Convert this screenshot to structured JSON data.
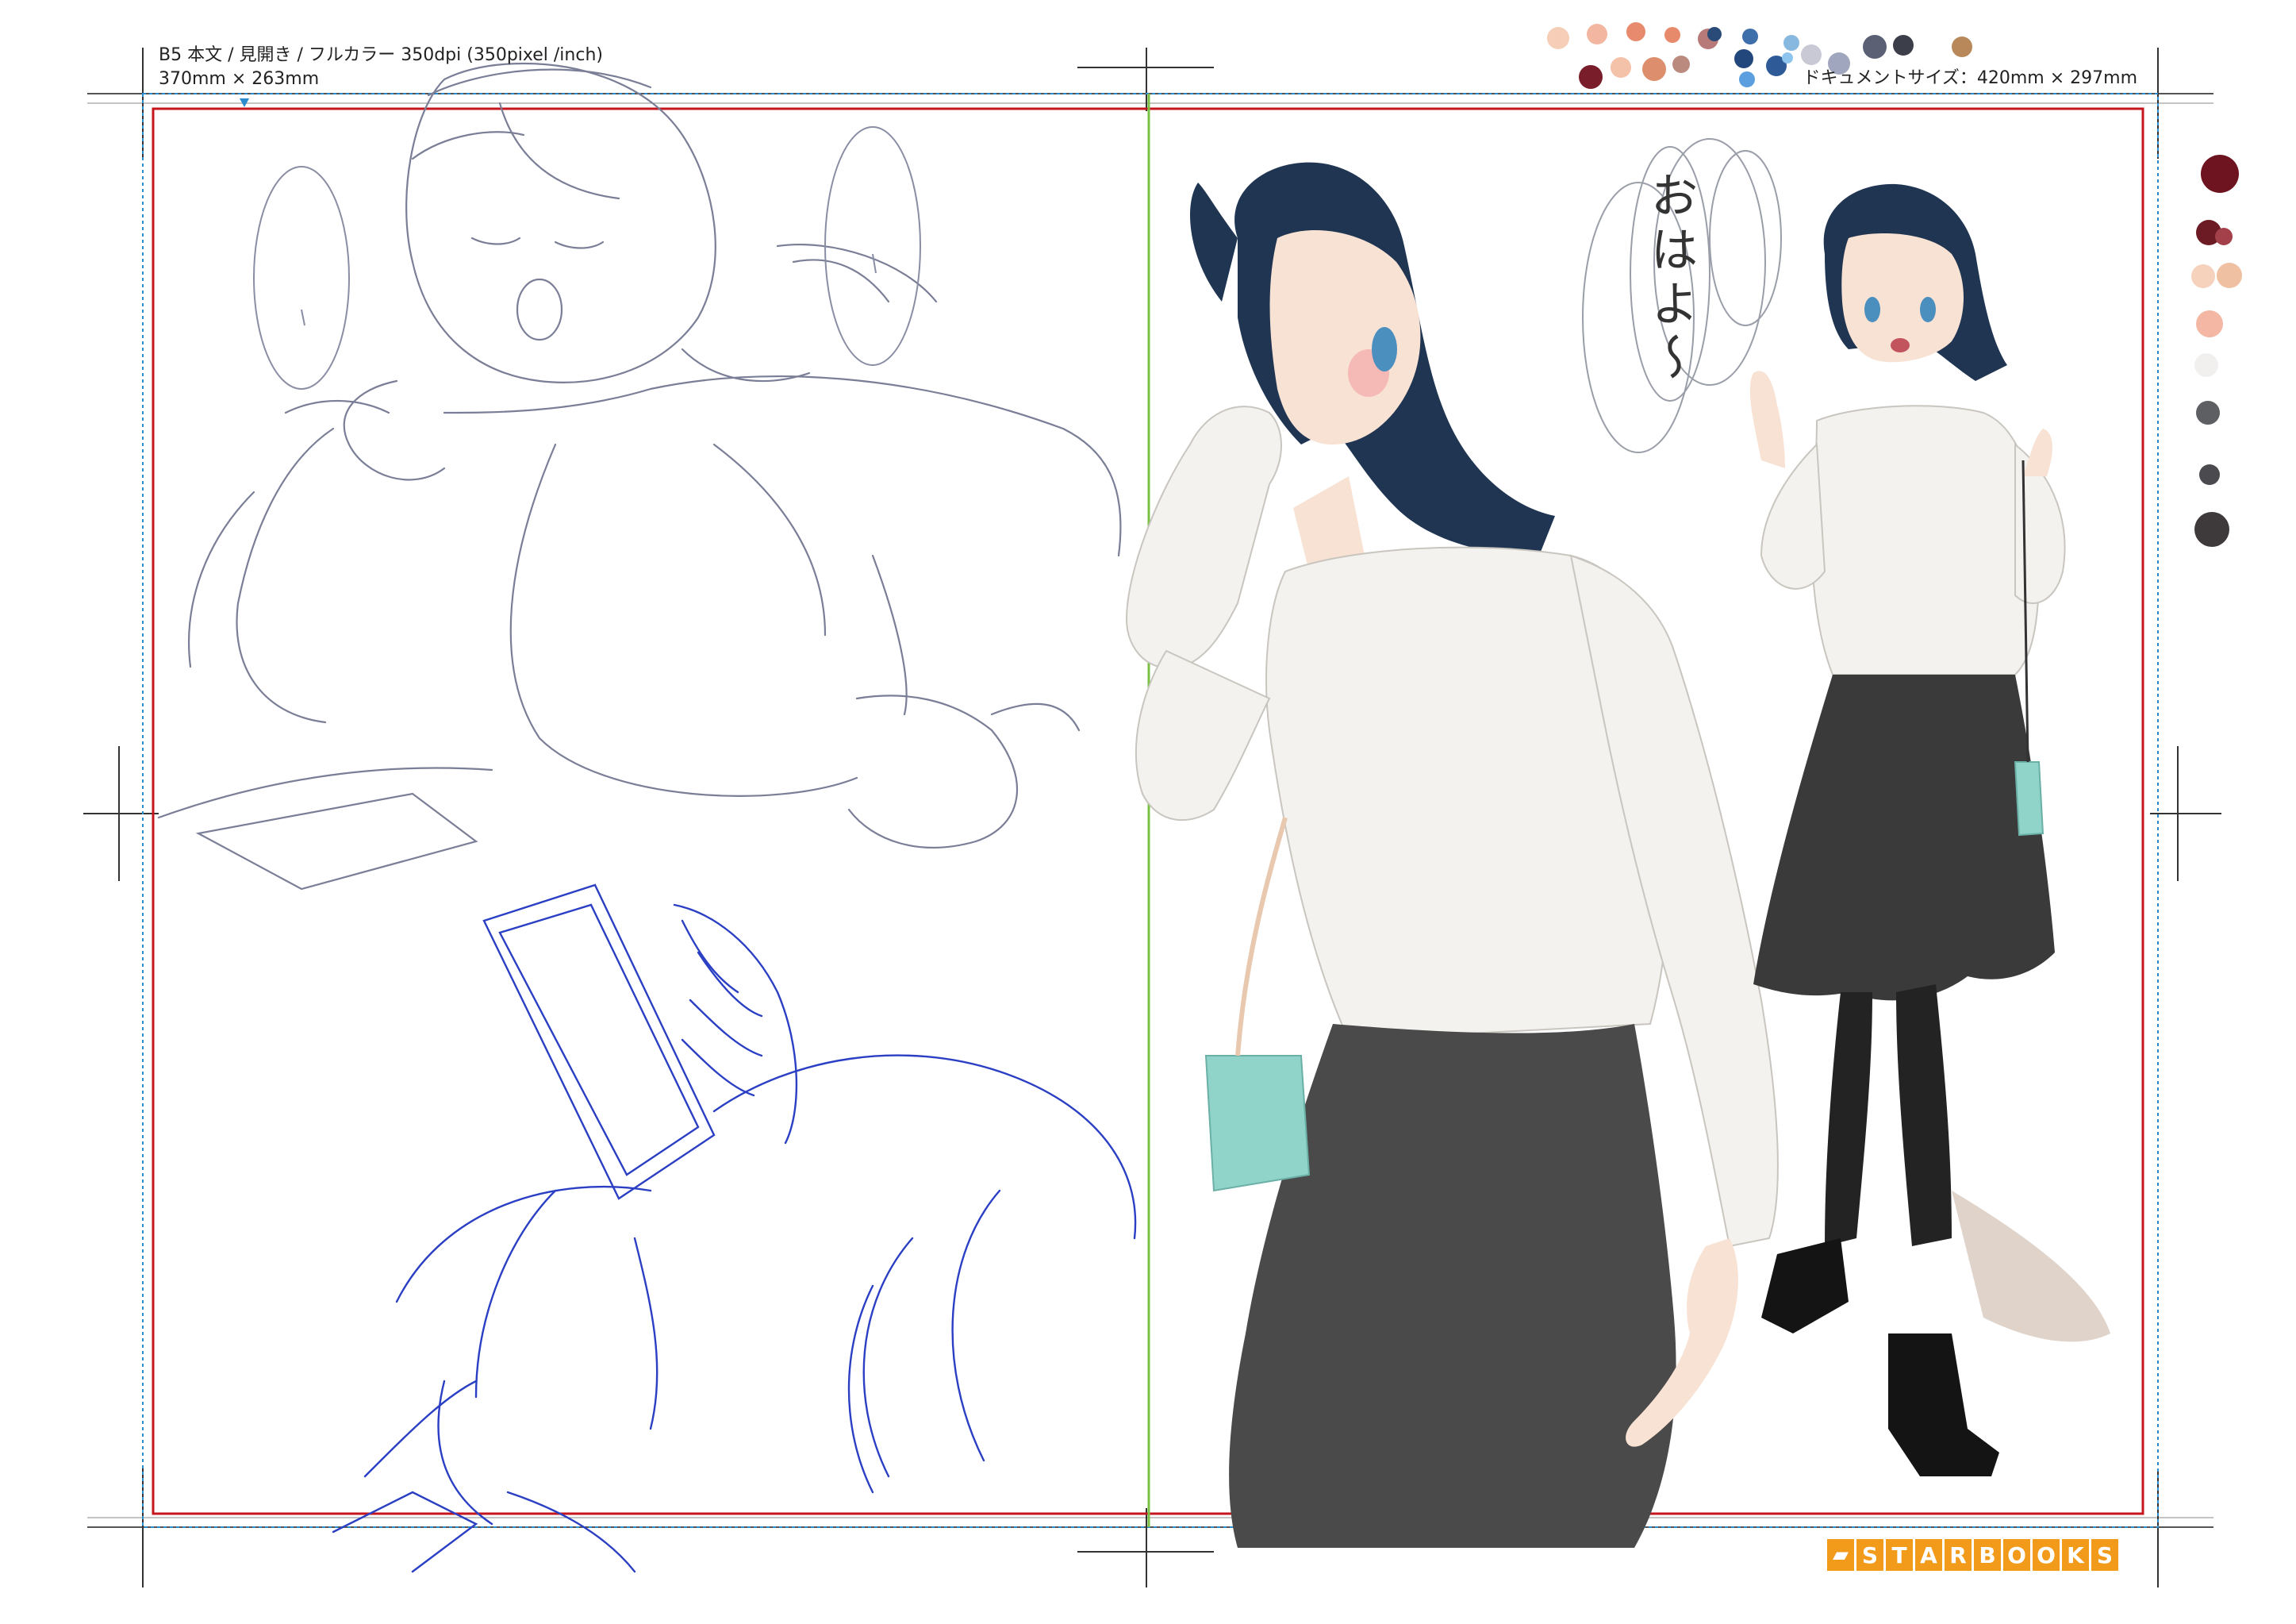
{
  "spec": {
    "line1": "B5 本文 / 見開き / フルカラー 350dpi (350pixel /inch)",
    "line2": "370mm × 263mm"
  },
  "document_size": "ドキュメントサイズ：420mm × 297mm",
  "speech_bubble_text": "おはよ〜",
  "logo": {
    "letters": [
      "S",
      "T",
      "A",
      "R",
      "B",
      "O",
      "O",
      "K",
      "S"
    ]
  },
  "icons": {
    "logo_mark": "starbooks-logo-icon"
  },
  "colors": {
    "bleed_line": "#2a8ccf",
    "trim_line": "#c4161c",
    "center_fold": "#7ac143",
    "logo_orange": "#f29a1a",
    "sketch_gray": "#7a7e96",
    "sketch_blue": "#2b3fc4",
    "hair": "#1f3552",
    "skin": "#f8e2d4",
    "skirt": "#4a4a4a",
    "bag": "#8fd3c9",
    "palette_top": [
      "#f6cdb6",
      "#f3b6a0",
      "#e88a6e",
      "#e78a6c",
      "#b77a78",
      "#7a1d2a",
      "#f4c2a8",
      "#dd8f6d",
      "#bb8a7f",
      "#2a4a78",
      "#3f6faa",
      "#22477d",
      "#5b9fe0",
      "#2e5b97",
      "#86b8e0",
      "#8ec5ee",
      "#c9c9d6",
      "#a0a6bd",
      "#5b6074",
      "#3c3f4a",
      "#b8885a"
    ],
    "palette_side": [
      "#6e1320",
      "#6c1a24",
      "#a3404a",
      "#f6d2bd",
      "#f0c0a2",
      "#f3b7a3",
      "#456190",
      "#b17d82",
      "#f2f0ef",
      "#5e5f63",
      "#4a4a4f",
      "#3e3a3c"
    ]
  }
}
